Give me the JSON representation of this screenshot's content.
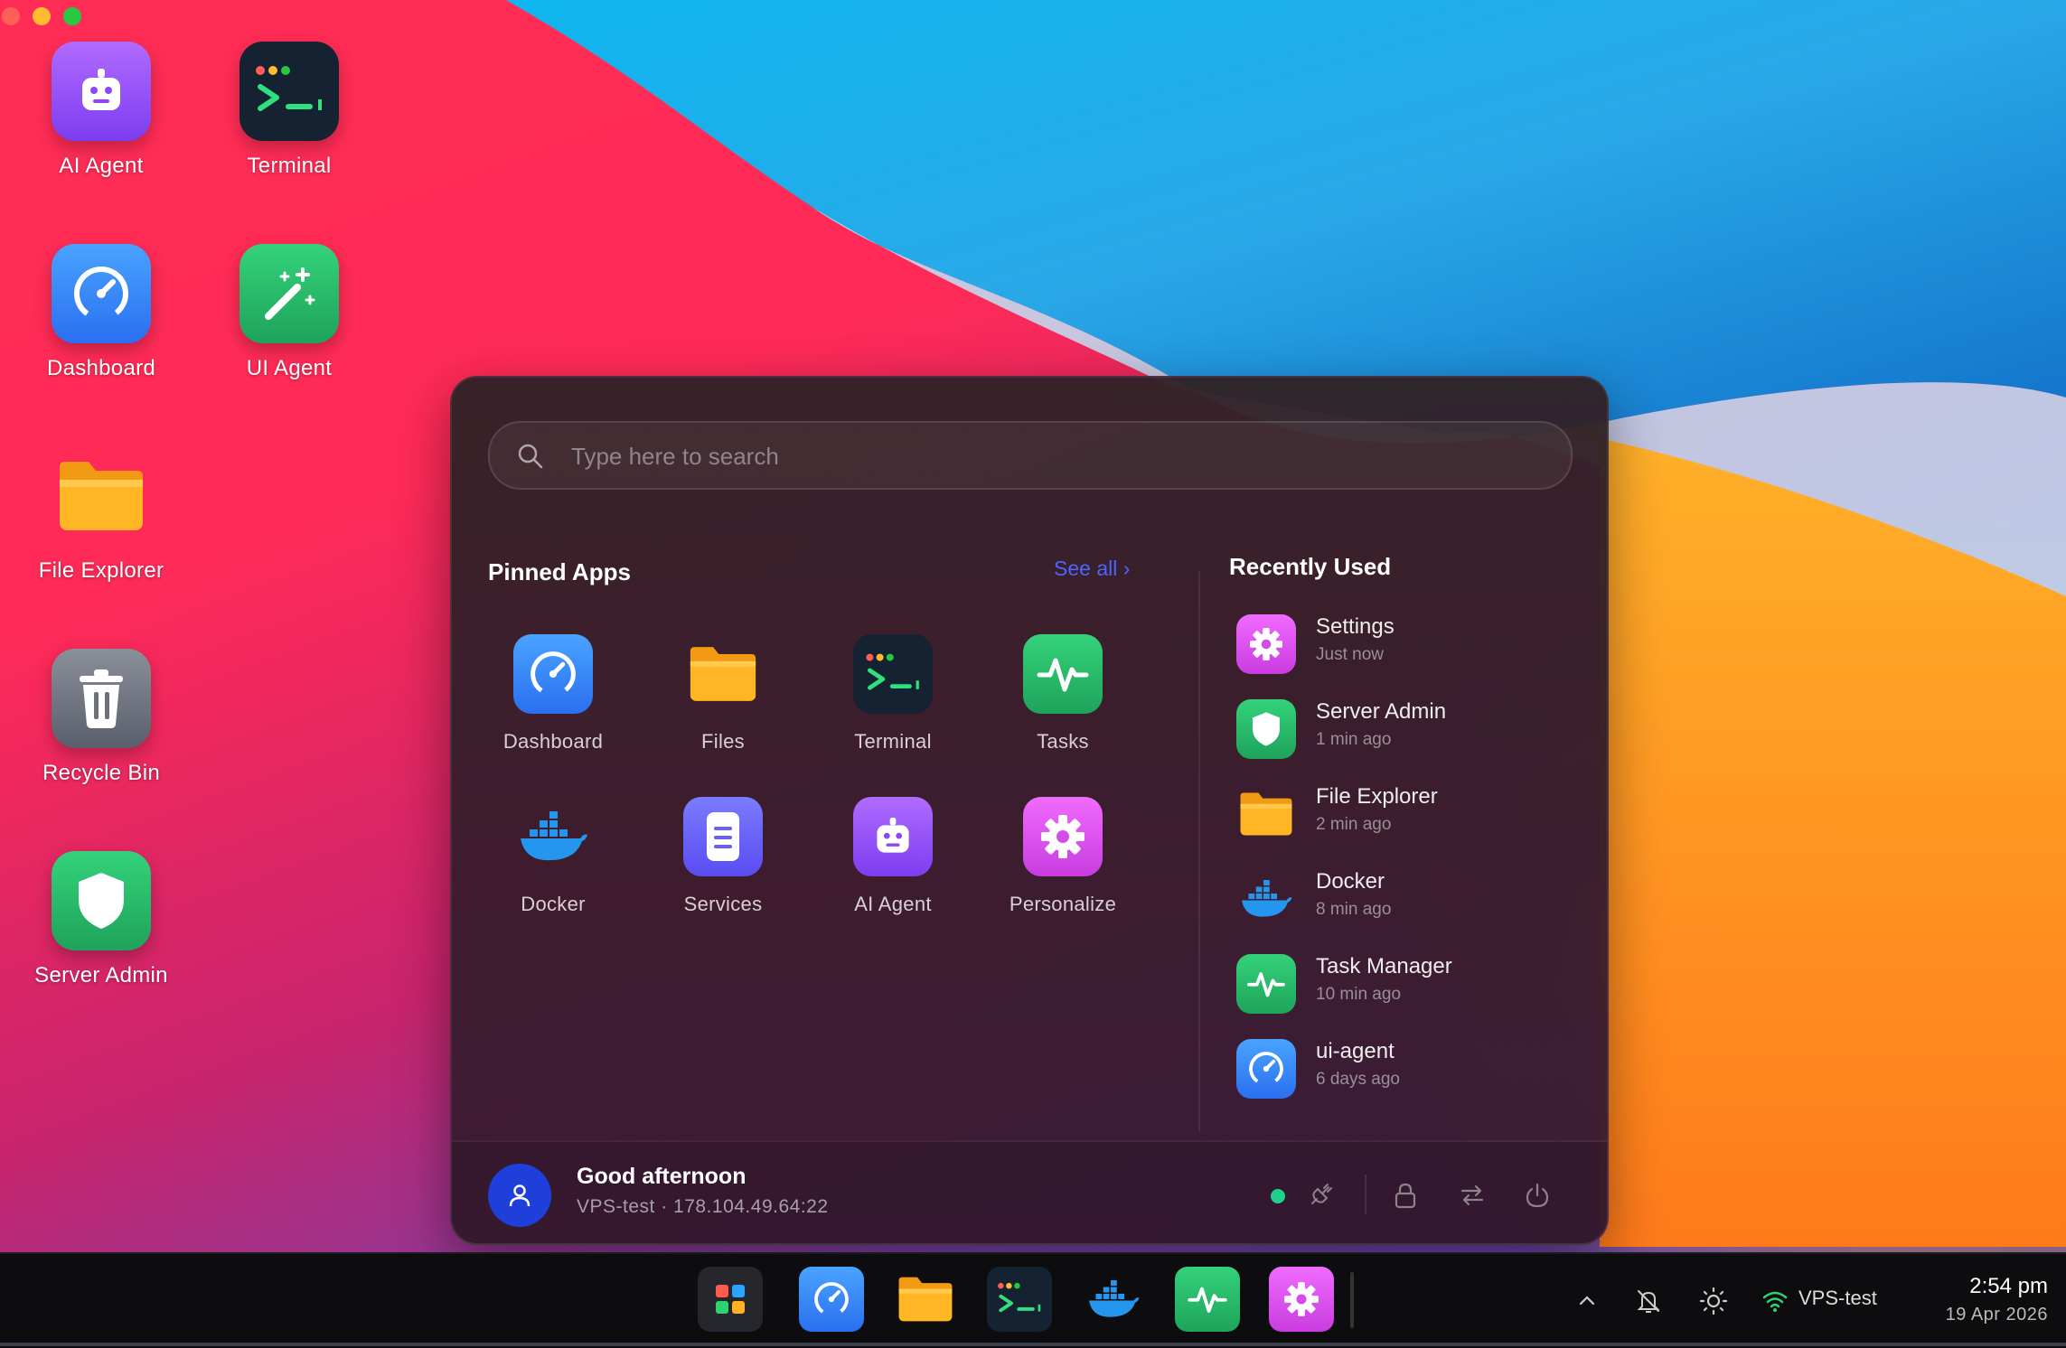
{
  "desktop": {
    "icons": [
      {
        "label": "AI Agent",
        "icon": "robot-icon"
      },
      {
        "label": "Terminal",
        "icon": "terminal-icon"
      },
      {
        "label": "Dashboard",
        "icon": "speedometer-icon"
      },
      {
        "label": "UI Agent",
        "icon": "magic-wand-icon"
      },
      {
        "label": "File Explorer",
        "icon": "folder-icon"
      },
      {
        "label": "Recycle Bin",
        "icon": "trash-icon"
      },
      {
        "label": "Server Admin",
        "icon": "shield-icon"
      }
    ]
  },
  "start_menu": {
    "search_placeholder": "Type here to search",
    "pinned_title": "Pinned Apps",
    "see_all": "See all",
    "recent_title": "Recently Used",
    "pinned": [
      {
        "label": "Dashboard",
        "icon": "speedometer-icon"
      },
      {
        "label": "Files",
        "icon": "folder-icon"
      },
      {
        "label": "Terminal",
        "icon": "terminal-icon"
      },
      {
        "label": "Tasks",
        "icon": "activity-icon"
      },
      {
        "label": "Docker",
        "icon": "docker-icon"
      },
      {
        "label": "Services",
        "icon": "server-icon"
      },
      {
        "label": "AI Agent",
        "icon": "robot-icon"
      },
      {
        "label": "Personalize",
        "icon": "gear-icon"
      }
    ],
    "recent": [
      {
        "name": "Settings",
        "time": "Just now",
        "icon": "gear-icon"
      },
      {
        "name": "Server Admin",
        "time": "1 min ago",
        "icon": "shield-icon"
      },
      {
        "name": "File Explorer",
        "time": "2 min ago",
        "icon": "folder-icon"
      },
      {
        "name": "Docker",
        "time": "8 min ago",
        "icon": "docker-icon"
      },
      {
        "name": "Task Manager",
        "time": "10 min ago",
        "icon": "activity-icon"
      },
      {
        "name": "ui-agent",
        "time": "6 days ago",
        "icon": "speedometer-icon"
      }
    ],
    "footer": {
      "greeting": "Good afternoon",
      "host": "VPS-test · 178.104.49.64:22"
    }
  },
  "taskbar": {
    "network_name": "VPS-test",
    "time": "2:54 pm",
    "date": "19 Apr 2026"
  },
  "colors": {
    "accent": "#4a66ff",
    "status_online": "#1fd18a"
  }
}
